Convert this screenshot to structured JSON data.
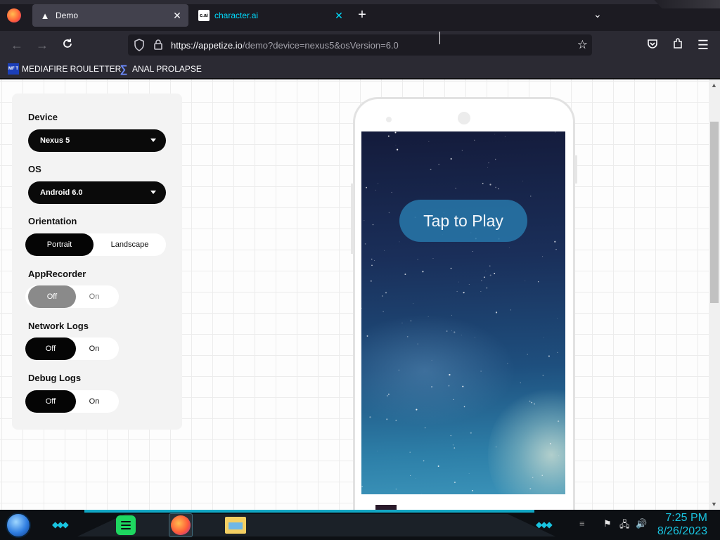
{
  "browser": {
    "tabs": [
      {
        "title": "Demo",
        "icon": "appetize-icon",
        "active": true
      },
      {
        "title": "character.ai",
        "icon": "character-ai-icon",
        "icon_text": "c.ai",
        "active": false
      }
    ],
    "new_tab_symbol": "+",
    "url": {
      "host": "https://appetize.io",
      "rest": "/demo?device=nexus5&osVersion=6.0"
    },
    "bookmarks": [
      {
        "label": "MEDIAFIRE ROULETTER",
        "icon_text": "MF T"
      },
      {
        "label": "ANAL PROLAPSE",
        "icon": "sigma-icon"
      }
    ]
  },
  "settings": {
    "device": {
      "label": "Device",
      "value": "Nexus 5"
    },
    "os": {
      "label": "OS",
      "value": "Android 6.0"
    },
    "orientation": {
      "label": "Orientation",
      "options": [
        "Portrait",
        "Landscape"
      ],
      "selected": "Portrait"
    },
    "app_recorder": {
      "label": "AppRecorder",
      "options": [
        "Off",
        "On"
      ],
      "selected": "Off",
      "disabled": true
    },
    "network_logs": {
      "label": "Network Logs",
      "options": [
        "Off",
        "On"
      ],
      "selected": "Off"
    },
    "debug_logs": {
      "label": "Debug Logs",
      "options": [
        "Off",
        "On"
      ],
      "selected": "Off"
    }
  },
  "emulator": {
    "play_button": "Tap to Play"
  },
  "taskbar": {
    "apps": [
      "spotify-icon",
      "firefox-icon",
      "file-explorer-icon"
    ],
    "time": "7:25 PM",
    "date": "8/26/2023"
  },
  "colors": {
    "accent_cyan": "#19c4e0",
    "tab_link": "#00ddff",
    "toggle_selected": "#050505"
  }
}
